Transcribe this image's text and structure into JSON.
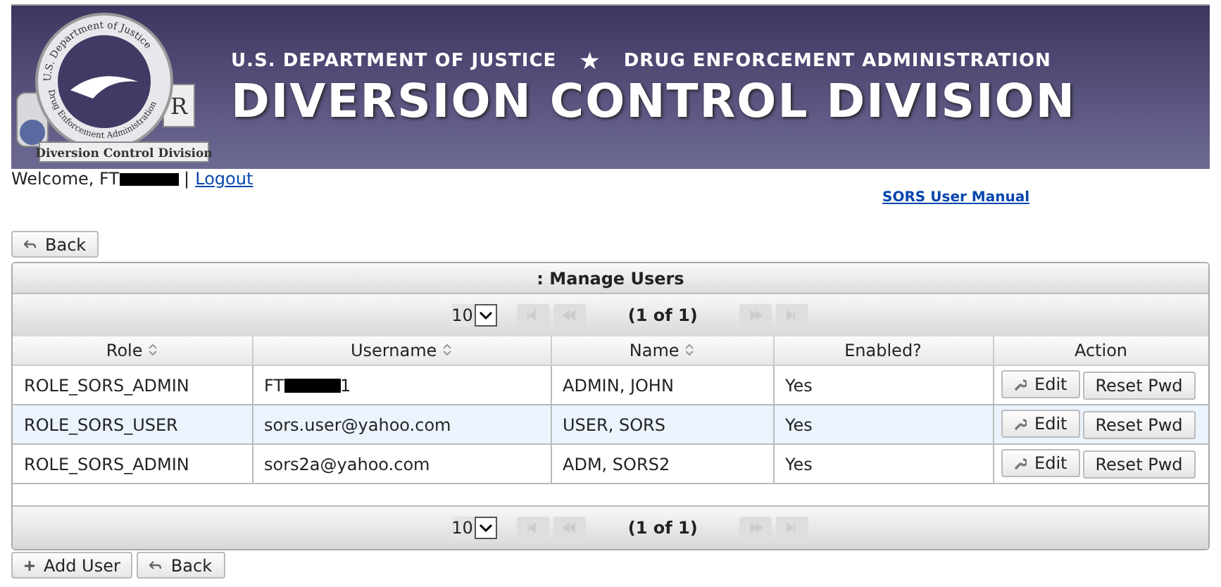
{
  "banner": {
    "seal_top": "U.S. Department of Justice",
    "seal_bottom": "Drug Enforcement Administration",
    "seal_caption": "Diversion Control Division",
    "seal_rx": "R",
    "overline_left": "U.S. DEPARTMENT OF JUSTICE",
    "star": "★",
    "overline_right": "DRUG ENFORCEMENT ADMINISTRATION",
    "title": "DIVERSION CONTROL DIVISION"
  },
  "user_bar": {
    "welcome": "Welcome, FT",
    "redacted": true,
    "separator": "|",
    "logout": "Logout",
    "manual_link": "SORS User Manual"
  },
  "top_buttons": [
    {
      "label": "Back",
      "kind": "back"
    }
  ],
  "panel": {
    "title": ": Manage Users",
    "paginator": {
      "page_size": "10",
      "page_report": "(1 of 1)"
    },
    "columns": [
      {
        "label": "Role",
        "sortable": true
      },
      {
        "label": "Username",
        "sortable": true
      },
      {
        "label": "Name",
        "sortable": true
      },
      {
        "label": "Enabled?",
        "sortable": false
      },
      {
        "label": "Action",
        "sortable": false
      }
    ],
    "rows": [
      {
        "role": "ROLE_SORS_ADMIN",
        "username": {
          "prefix": "FT",
          "redacted": true,
          "suffix": "1"
        },
        "name": "ADMIN, JOHN",
        "enabled": "Yes",
        "selected": false,
        "actions": [
          "Edit",
          "Reset Pwd"
        ]
      },
      {
        "role": "ROLE_SORS_USER",
        "username": {
          "prefix": "sors.user@yahoo.com",
          "redacted": false
        },
        "name": "USER, SORS",
        "enabled": "Yes",
        "selected": true,
        "actions": [
          "Edit",
          "Reset Pwd"
        ]
      },
      {
        "role": "ROLE_SORS_ADMIN",
        "username": {
          "prefix": "sors2a@yahoo.com",
          "redacted": false
        },
        "name": "ADM, SORS2",
        "enabled": "Yes",
        "selected": false,
        "actions": [
          "Edit",
          "Reset Pwd"
        ]
      }
    ],
    "bottom_paginator": {
      "page_size": "10",
      "page_report": "(1 of 1)"
    }
  },
  "bottom_buttons": [
    {
      "label": "Add User",
      "kind": "add"
    },
    {
      "label": "Back",
      "kind": "back"
    }
  ]
}
